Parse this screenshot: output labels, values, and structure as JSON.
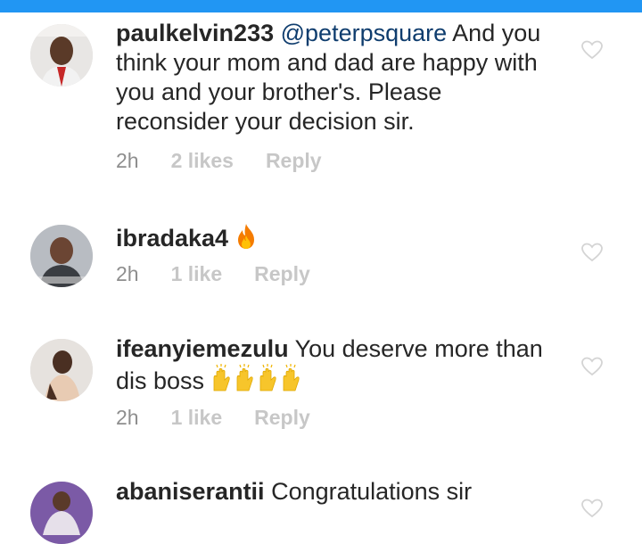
{
  "comments": [
    {
      "username": "paulkelvin233",
      "mention": "@peterpsquare",
      "text": " And you think your mom and dad are happy with you and your brother's. Please reconsider your decision sir.",
      "time": "2h",
      "likes": "2 likes",
      "reply": "Reply"
    },
    {
      "username": "ibradaka4",
      "mention": "",
      "text": "",
      "emoji": "fire-emoji",
      "time": "2h",
      "likes": "1 like",
      "reply": "Reply"
    },
    {
      "username": "ifeanyiemezulu",
      "mention": "",
      "text": " You deserve more than dis boss ",
      "emoji": "raising-hands-emoji x4",
      "time": "2h",
      "likes": "1 like",
      "reply": "Reply"
    },
    {
      "username": "abaniserantii",
      "mention": "",
      "text": " Congratulations sir",
      "time": "",
      "likes": "",
      "reply": ""
    }
  ],
  "colors": {
    "topbar": "#2196f3",
    "text": "#262626",
    "mention": "#0f3d6e",
    "meta": "#8e8e8e",
    "meta_light": "#c7c7c7"
  },
  "icons": [
    "heart-outline-icon",
    "fire-emoji",
    "raising-hands-emoji"
  ]
}
